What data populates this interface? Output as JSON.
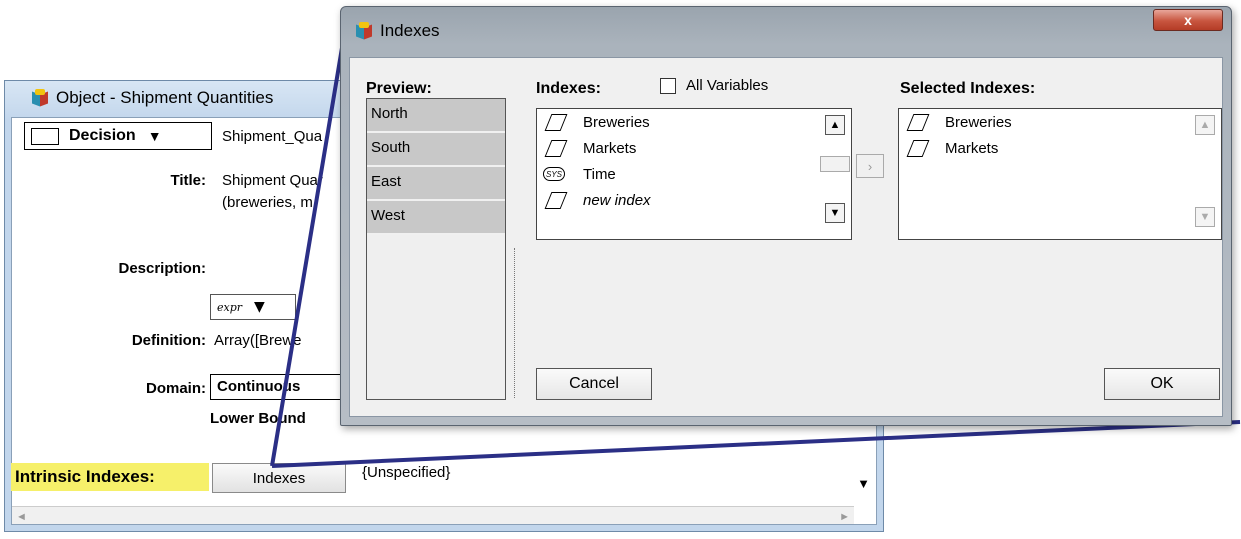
{
  "object_window": {
    "title": "Object - Shipment Quantities",
    "class_label": "Decision",
    "identifier": "Shipment_Qua",
    "title_label": "Title:",
    "title_value_line1": "Shipment Quar",
    "title_value_line2": "(breweries, m",
    "description_label": "Description:",
    "definition_type": "expr",
    "definition_label": "Definition:",
    "definition_value": "Array([Brewe",
    "domain_label": "Domain:",
    "domain_value": "Continuous",
    "lower_bound_label": "Lower Bound",
    "intrinsic_indexes_label": "Intrinsic Indexes:",
    "indexes_button": "Indexes",
    "indexes_value": "{Unspecified}"
  },
  "dialog": {
    "title": "Indexes",
    "close_label": "x",
    "preview_label": "Preview:",
    "preview_items": [
      "North",
      "South",
      "East",
      "West"
    ],
    "indexes_label": "Indexes:",
    "all_variables_label": "All Variables",
    "indexes_list": [
      {
        "label": "Breweries",
        "icon": "index-icon",
        "italic": false
      },
      {
        "label": "Markets",
        "icon": "index-icon",
        "italic": false
      },
      {
        "label": "Time",
        "icon": "sys-icon",
        "italic": false
      },
      {
        "label": "new index",
        "icon": "index-icon",
        "italic": true
      }
    ],
    "sys_badge": "SYS",
    "selected_label": "Selected Indexes:",
    "selected_list": [
      {
        "label": "Breweries",
        "icon": "index-icon"
      },
      {
        "label": "Markets",
        "icon": "index-icon"
      }
    ],
    "cancel_button": "Cancel",
    "ok_button": "OK"
  },
  "colors": {
    "highlight_yellow": "#f6f06a",
    "callout_line": "#2b2f86",
    "close_red": "#c8553f"
  }
}
